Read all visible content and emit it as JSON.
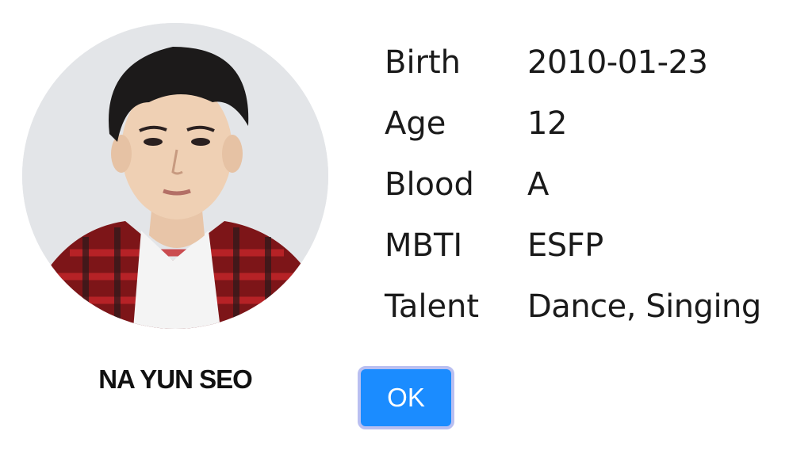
{
  "profile": {
    "name": "NA YUN SEO",
    "photo": "profile-photo",
    "fields": [
      {
        "label": "Birth",
        "value": "2010-01-23"
      },
      {
        "label": "Age",
        "value": "12"
      },
      {
        "label": "Blood",
        "value": "A"
      },
      {
        "label": "MBTI",
        "value": "ESFP"
      },
      {
        "label": "Talent",
        "value": "Dance, Singing"
      }
    ]
  },
  "ok_button": {
    "label": "OK"
  },
  "colors": {
    "button_bg": "#1b8cff",
    "button_border": "#b9bff1",
    "text": "#1a1a1a"
  }
}
